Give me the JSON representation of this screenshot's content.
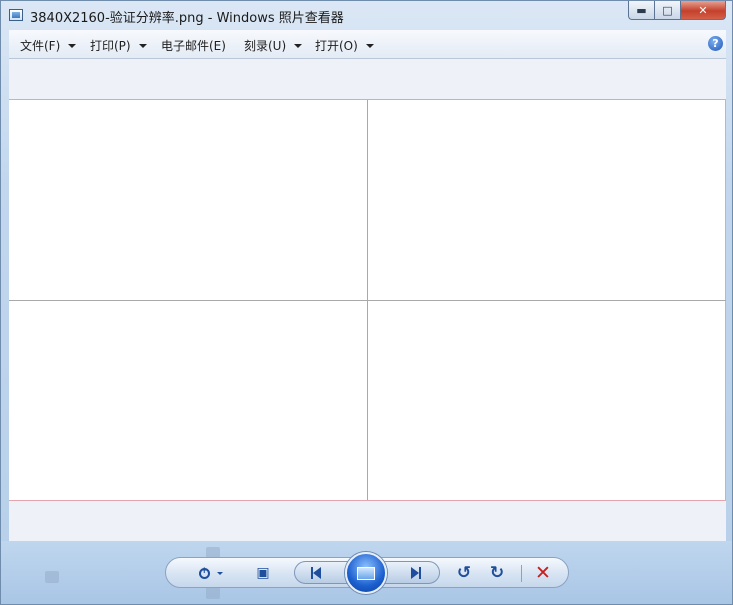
{
  "window": {
    "title": "3840X2160-验证分辨率.png - Windows 照片查看器",
    "icon": "photo-viewer-app-icon"
  },
  "menubar": {
    "items": [
      {
        "label": "文件(F)",
        "has_dropdown": true
      },
      {
        "label": "打印(P)",
        "has_dropdown": true
      },
      {
        "label": "电子邮件(E)",
        "has_dropdown": false
      },
      {
        "label": "刻录(U)",
        "has_dropdown": true
      },
      {
        "label": "打开(O)",
        "has_dropdown": true
      }
    ],
    "help_icon": "?"
  },
  "viewer": {
    "image_description": "white image divided into four quadrants by gray lines"
  },
  "controls": {
    "zoom": "zoom-icon",
    "actual_size": "fit-to-window-icon",
    "previous": "previous-icon",
    "slideshow": "slideshow-icon",
    "next": "next-icon",
    "rotate_ccw": "↺",
    "rotate_cw": "↻",
    "delete": "✕"
  },
  "colors": {
    "accent": "#1f4e9c",
    "delete": "#c81e1e",
    "image_border": "#e3a6ad"
  }
}
